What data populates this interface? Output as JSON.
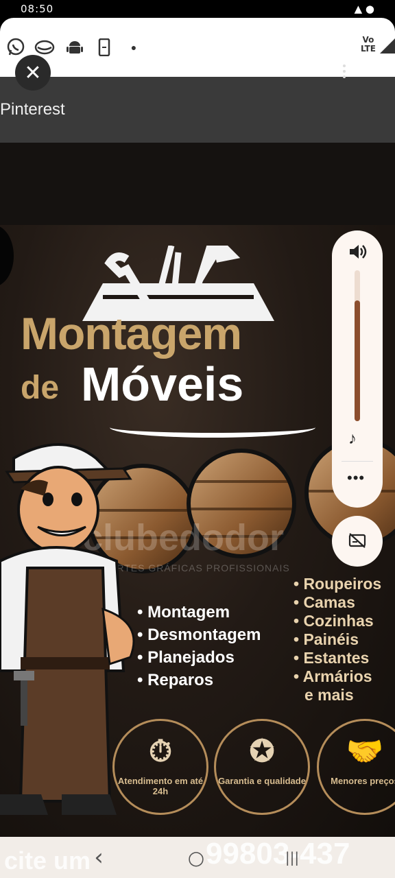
{
  "status_bar": {
    "time": "08:50"
  },
  "notification_icons": [
    "whatsapp-icon",
    "message-icon",
    "android-icon",
    "phone-icon",
    "dot-icon"
  ],
  "network": {
    "label_top": "Vo",
    "label_bottom": "LTE"
  },
  "app_bar": {
    "title": "Pinterest",
    "close_label": "✕"
  },
  "poster": {
    "title_line1": "Montagem",
    "title_line2_prefix": "de",
    "title_line2": "Móveis",
    "watermark": "clubedodor",
    "watermark_sub": "ARTES GRÁFICAS PROFISSIONAIS",
    "services_left": [
      "• Montagem",
      "• Desmontagem",
      "• Planejados",
      "• Reparos"
    ],
    "services_right": [
      "• Roupeiros",
      "• Camas",
      "• Cozinhas",
      "• Painéis",
      "• Estantes",
      "• Armários",
      "e mais"
    ],
    "badges": [
      {
        "icon": "clock-24-icon",
        "glyph": "⏱",
        "label": "Atendimento em até 24h"
      },
      {
        "icon": "medal-icon",
        "glyph": "✪",
        "label": "Garantia e qualidade"
      },
      {
        "icon": "handshake-icon",
        "glyph": "🤝",
        "label": "Menores preços"
      }
    ],
    "phone_lead": "cite um",
    "phone": "99803-437"
  },
  "volume_panel": {
    "level": 0.8,
    "more_label": "•••"
  },
  "nav": {
    "back": "‹",
    "home": "○",
    "recents": "|||"
  }
}
